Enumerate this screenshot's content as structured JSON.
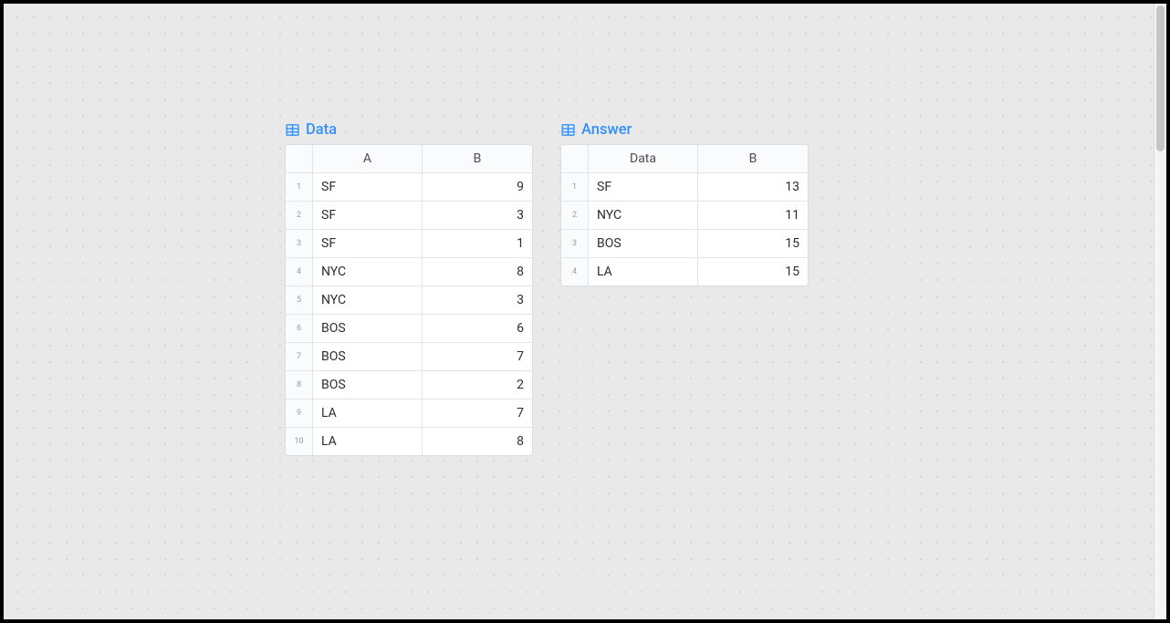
{
  "tables": {
    "data": {
      "title": "Data",
      "columns": [
        "A",
        "B"
      ],
      "rows": [
        {
          "n": "1",
          "a": "SF",
          "b": "9"
        },
        {
          "n": "2",
          "a": "SF",
          "b": "3"
        },
        {
          "n": "3",
          "a": "SF",
          "b": "1"
        },
        {
          "n": "4",
          "a": "NYC",
          "b": "8"
        },
        {
          "n": "5",
          "a": "NYC",
          "b": "3"
        },
        {
          "n": "6",
          "a": "BOS",
          "b": "6"
        },
        {
          "n": "7",
          "a": "BOS",
          "b": "7"
        },
        {
          "n": "8",
          "a": "BOS",
          "b": "2"
        },
        {
          "n": "9",
          "a": "LA",
          "b": "7"
        },
        {
          "n": "10",
          "a": "LA",
          "b": "8"
        }
      ]
    },
    "answer": {
      "title": "Answer",
      "columns": [
        "Data",
        "B"
      ],
      "rows": [
        {
          "n": "1",
          "a": "SF",
          "b": "13"
        },
        {
          "n": "2",
          "a": "NYC",
          "b": "11"
        },
        {
          "n": "3",
          "a": "BOS",
          "b": "15"
        },
        {
          "n": "4",
          "a": "LA",
          "b": "15"
        }
      ]
    }
  }
}
